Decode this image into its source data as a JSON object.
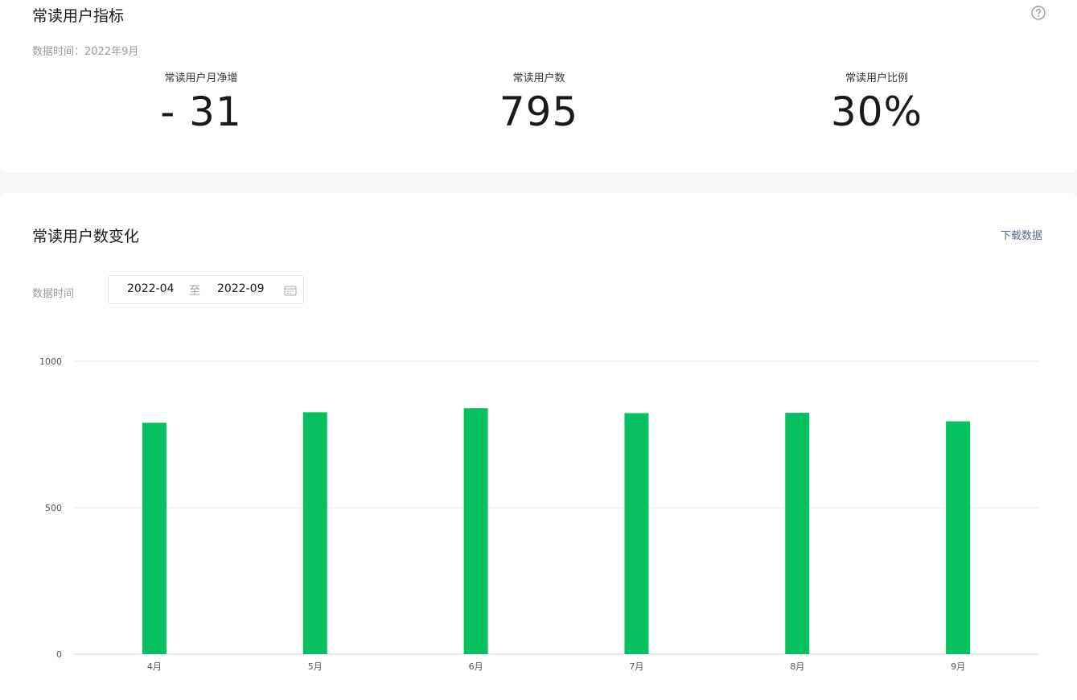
{
  "metrics_card": {
    "title": "常读用户指标",
    "help_icon": "question-circle-icon",
    "data_time": "数据时间：2022年9月",
    "metrics": [
      {
        "label": "常读用户月净增",
        "value": "- 31"
      },
      {
        "label": "常读用户数",
        "value": "795"
      },
      {
        "label": "常读用户比例",
        "value": "30%"
      }
    ]
  },
  "chart_card": {
    "title": "常读用户数变化",
    "download_label": "下载数据",
    "range_label": "数据时间",
    "range_start": "2022-04",
    "range_separator": "至",
    "range_end": "2022-09",
    "calendar_icon": "calendar-icon"
  },
  "colors": {
    "bar": "#07c160",
    "link": "#576b95",
    "grid": "#e7e7e7"
  },
  "chart_data": {
    "type": "bar",
    "categories": [
      "4月",
      "5月",
      "6月",
      "7月",
      "8月",
      "9月"
    ],
    "values": [
      790,
      826,
      840,
      823,
      824,
      795
    ],
    "ylim": [
      0,
      1000
    ],
    "yticks": [
      0,
      500,
      1000
    ],
    "grid": true,
    "legend": "none"
  }
}
